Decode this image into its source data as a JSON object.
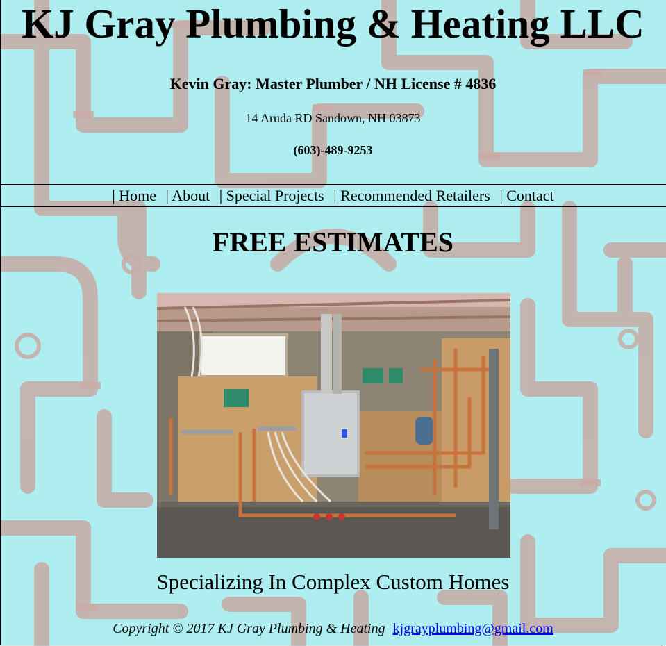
{
  "header": {
    "title": "KJ Gray Plumbing & Heating LLC",
    "subtitle": "Kevin Gray: Master Plumber / NH License # 4836",
    "address": "14 Aruda RD Sandown, NH 03873",
    "phone": "(603)-489-9253"
  },
  "nav": {
    "separator": "|",
    "items": [
      {
        "label": "Home"
      },
      {
        "label": "About"
      },
      {
        "label": "Special Projects"
      },
      {
        "label": "Recommended Retailers"
      },
      {
        "label": "Contact"
      }
    ]
  },
  "main": {
    "headline": "FREE ESTIMATES",
    "tagline": "Specializing In Complex Custom Homes"
  },
  "footer": {
    "copyright": "Copyright © 2017 KJ Gray Plumbing & Heating",
    "email": "kjgrayplumbing@gmail.com"
  },
  "colors": {
    "background": "#aeeef0",
    "pipe_pattern": "#c7a9a6",
    "link": "#0000ee"
  }
}
